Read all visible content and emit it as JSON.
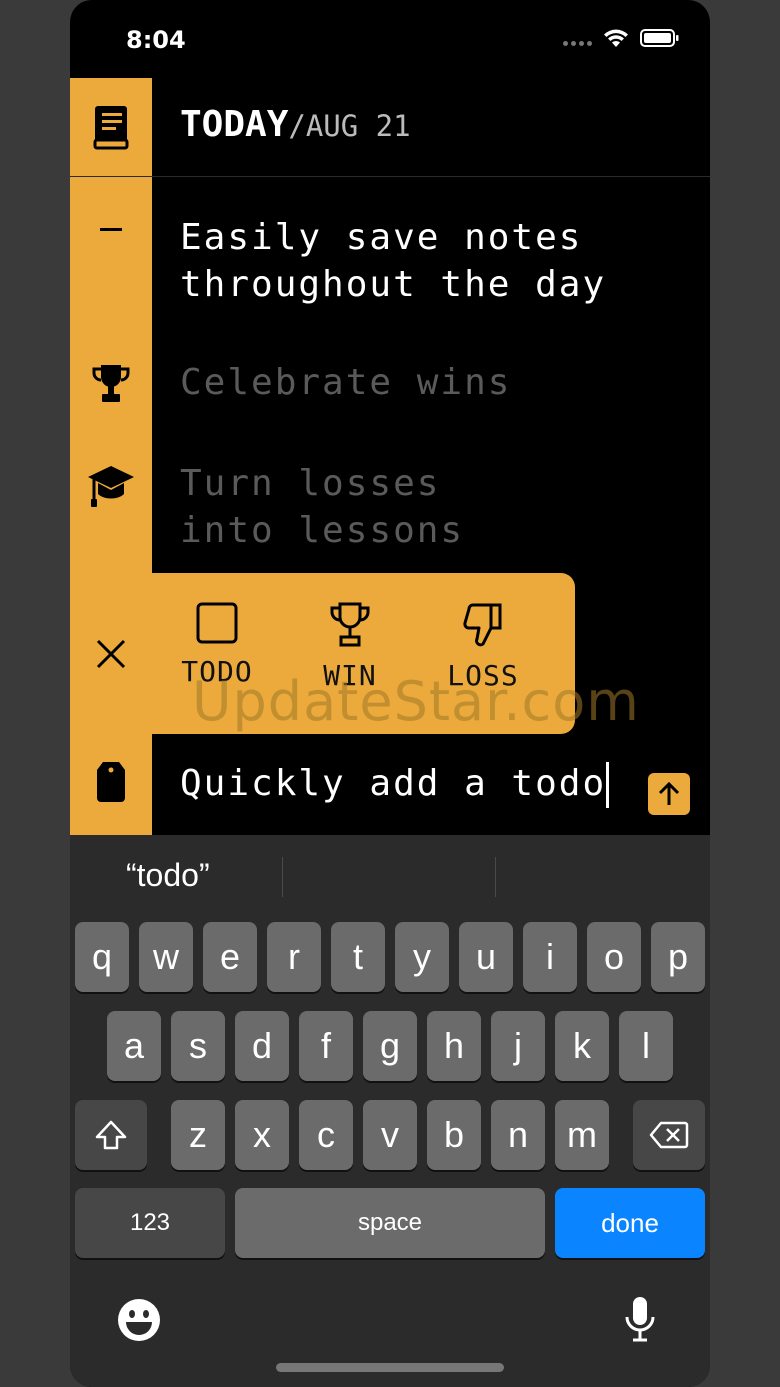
{
  "status_bar": {
    "time": "8:04"
  },
  "header": {
    "title": "TODAY",
    "slash": "/",
    "date": "AUG 21"
  },
  "notes": {
    "primary": "Easily save notes\nthroughout the day",
    "wins": "Celebrate wins",
    "losses": "Turn losses\ninto lessons"
  },
  "sidebar": {
    "icons": [
      "journal-icon",
      "dash-icon",
      "trophy-icon",
      "graduation-cap-icon",
      "close-icon",
      "tag-icon"
    ]
  },
  "picker": {
    "options": [
      {
        "label": "TODO",
        "icon": "checkbox-icon"
      },
      {
        "label": "WIN",
        "icon": "trophy-icon"
      },
      {
        "label": "LOSS",
        "icon": "thumbs-down-icon"
      }
    ]
  },
  "watermark": "UpdateStar.com",
  "input": {
    "value": "Quickly add a todo"
  },
  "keyboard": {
    "suggestion": "“todo”",
    "row1": [
      "q",
      "w",
      "e",
      "r",
      "t",
      "y",
      "u",
      "i",
      "o",
      "p"
    ],
    "row2": [
      "a",
      "s",
      "d",
      "f",
      "g",
      "h",
      "j",
      "k",
      "l"
    ],
    "row3": [
      "z",
      "x",
      "c",
      "v",
      "b",
      "n",
      "m"
    ],
    "numbers_label": "123",
    "space_label": "space",
    "done_label": "done"
  },
  "colors": {
    "accent": "#EBAA3B",
    "done": "#0A84FF",
    "background": "#000000"
  }
}
